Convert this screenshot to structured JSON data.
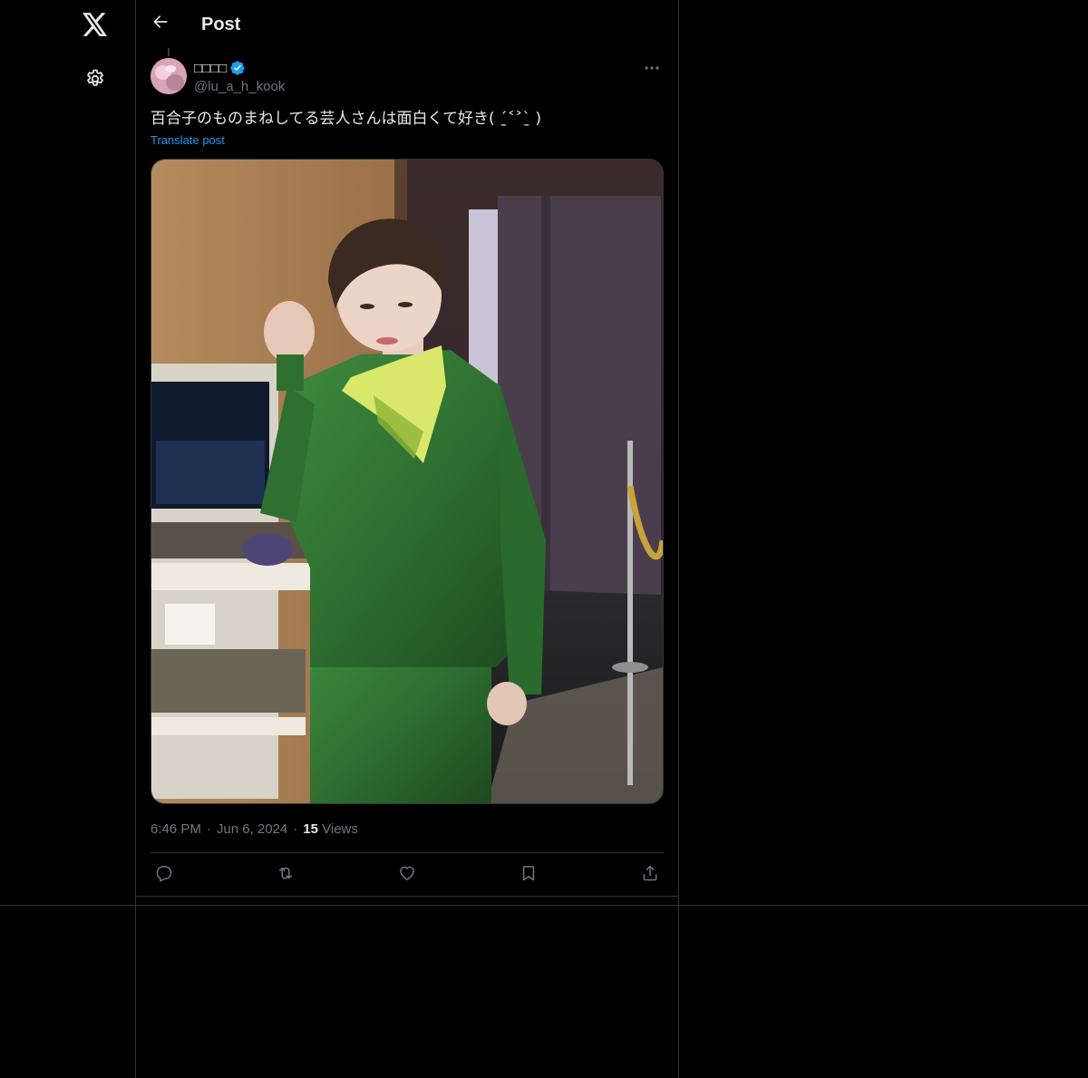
{
  "app": {
    "name": "X",
    "colors": {
      "background": "#000000",
      "text_primary": "#e7e9ea",
      "text_secondary": "#71767b",
      "accent": "#1d9bf0",
      "border": "#2f3336"
    }
  },
  "nav": {
    "logo_icon": "x-logo-icon",
    "settings_icon": "gear-icon"
  },
  "header": {
    "back_icon": "arrow-left-icon",
    "title": "Post"
  },
  "post": {
    "author": {
      "display_name": "□□□□",
      "handle": "@lu_a_h_kook",
      "verified": true,
      "verified_icon": "verified-badge-icon"
    },
    "more_icon": "more-horizontal-icon",
    "text": "百合子のものまねしてる芸人さんは面白くて好き( ˊ̱˂˃ˋ̱ )",
    "translate_label": "Translate post",
    "media": {
      "type": "photo"
    },
    "time": "6:46 PM",
    "date": "Jun 6, 2024",
    "views_count": "15",
    "views_label": "Views",
    "actions": [
      {
        "icon": "reply-icon"
      },
      {
        "icon": "repost-icon"
      },
      {
        "icon": "like-icon"
      },
      {
        "icon": "bookmark-icon"
      },
      {
        "icon": "share-icon"
      }
    ]
  }
}
